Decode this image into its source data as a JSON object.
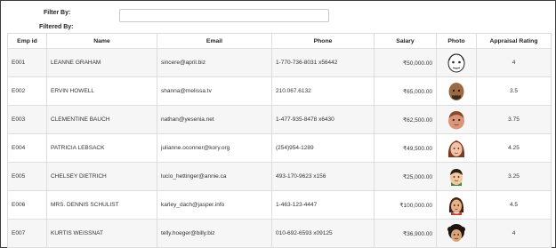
{
  "filter": {
    "label": "Filter By:",
    "value": "",
    "filtered_label": "Filtered By:"
  },
  "table": {
    "headers": {
      "id": "Emp id",
      "name": "Name",
      "email": "Email",
      "phone": "Phone",
      "salary": "Salary",
      "photo": "Photo",
      "rating": "Appraisal Rating"
    },
    "rows": [
      {
        "id": "E001",
        "name": "LEANNE GRAHAM",
        "email": "sincere@april.biz",
        "phone": "1-770-736-8031 x56442",
        "salary": "₹50,000.00",
        "photo": "avatar-sketch-face-icon",
        "rating": "4"
      },
      {
        "id": "E002",
        "name": "ERVIN HOWELL",
        "email": "shanna@melissa.tv",
        "phone": "210.067.6132",
        "salary": "₹65,000.00",
        "photo": "avatar-bald-man-icon",
        "rating": "3.5"
      },
      {
        "id": "E003",
        "name": "CLEMENTINE BAUCH",
        "email": "nathan@yesenia.net",
        "phone": "1-477-935-8478 x6430",
        "salary": "₹62,500.00",
        "photo": "avatar-man-face-icon",
        "rating": "3.75"
      },
      {
        "id": "E004",
        "name": "PATRICIA LEBSACK",
        "email": "julianne.oconner@kory.org",
        "phone": "(254)954-1289",
        "salary": "₹49,500.00",
        "photo": "avatar-woman-face-icon",
        "rating": "4.25"
      },
      {
        "id": "E005",
        "name": "CHELSEY DIETRICH",
        "email": "lucio_hettinger@annie.ca",
        "phone": "493-170-9623 x156",
        "salary": "₹25,000.00",
        "photo": "avatar-man-cartoon-icon",
        "rating": "3.25"
      },
      {
        "id": "E006",
        "name": "MRS. DENNIS SCHULIST",
        "email": "karley_dach@jasper.info",
        "phone": "1-463-123-4447",
        "salary": "₹100,000.00",
        "photo": "avatar-woman-cartoon-icon",
        "rating": "4.5"
      },
      {
        "id": "E007",
        "name": "KURTIS WEISSNAT",
        "email": "telly.hoeger@billy.biz",
        "phone": "010-692-6593 x09125",
        "salary": "₹36,900.00",
        "photo": "avatar-curly-hair-icon",
        "rating": "4"
      }
    ]
  }
}
